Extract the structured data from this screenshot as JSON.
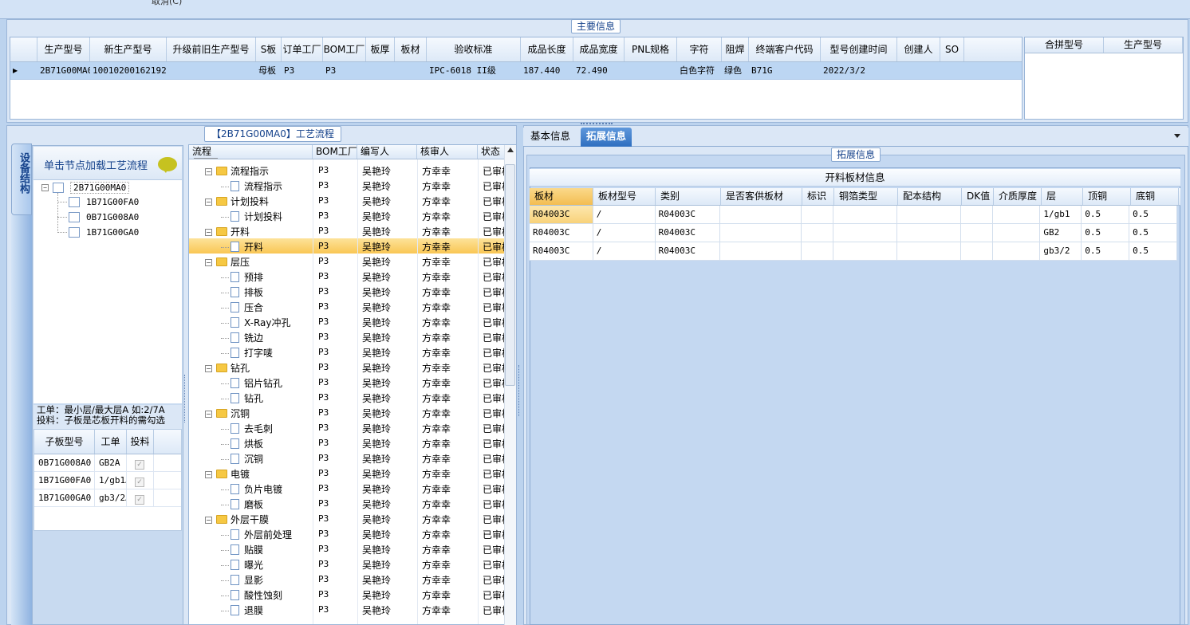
{
  "top_strip": {
    "partial_text": "取消(C)"
  },
  "main_info": {
    "title": "主要信息",
    "columns": [
      "生产型号",
      "新生产型号",
      "升级前旧生产型号",
      "S板",
      "订单工厂",
      "BOM工厂",
      "板厚",
      "板材",
      "验收标准",
      "成品长度",
      "成品宽度",
      "PNL规格",
      "字符",
      "阻焊",
      "终端客户代码",
      "型号创建时间",
      "创建人",
      "SO"
    ],
    "row": [
      "2B71G00MA0",
      "10010200162192",
      "",
      "母板",
      "P3",
      "P3",
      "",
      "",
      "IPC-6018 II级",
      "187.440",
      "72.490",
      "",
      "白色字符",
      "绿色",
      "B71G",
      "2022/3/2",
      "",
      ""
    ],
    "merge_columns": [
      "合拼型号",
      "生产型号"
    ]
  },
  "left": {
    "vertical_tab": "设备结构",
    "header_label": "单击节点加载工艺流程",
    "tree": {
      "root": "2B71G00MA0",
      "children": [
        "1B71G00FA0",
        "0B71G008A0",
        "1B71G00GA0"
      ]
    },
    "hint_line1": "工单：最小层/最大层A 如:2/7A",
    "hint_line2": "投料：子板是芯板开料的需勾选",
    "sub_columns": [
      "子板型号",
      "工单",
      "投料"
    ],
    "sub_rows": [
      {
        "model": "0B71G008A0",
        "order": "GB2A",
        "feed": true
      },
      {
        "model": "1B71G00FA0",
        "order": "1/gb1A",
        "feed": true
      },
      {
        "model": "1B71G00GA0",
        "order": "gb3/2A",
        "feed": true
      }
    ]
  },
  "process": {
    "title": "【2B71G00MA0】工艺流程",
    "columns": [
      "流程",
      "BOM工厂",
      "编写人",
      "核审人",
      "状态"
    ],
    "bom": "P3",
    "writer": "吴艳玲",
    "reviewer": "方幸幸",
    "status": "已审核",
    "rows": [
      {
        "label": "流程指示",
        "level": 0
      },
      {
        "label": "流程指示",
        "level": 1
      },
      {
        "label": "计划投料",
        "level": 0
      },
      {
        "label": "计划投料",
        "level": 1
      },
      {
        "label": "开料",
        "level": 0
      },
      {
        "label": "开料",
        "level": 1,
        "selected": true
      },
      {
        "label": "层压",
        "level": 0
      },
      {
        "label": "预排",
        "level": 1
      },
      {
        "label": "排板",
        "level": 1
      },
      {
        "label": "压合",
        "level": 1
      },
      {
        "label": "X-Ray冲孔",
        "level": 1
      },
      {
        "label": "铣边",
        "level": 1
      },
      {
        "label": "打字唛",
        "level": 1
      },
      {
        "label": "钻孔",
        "level": 0
      },
      {
        "label": "铝片钻孔",
        "level": 1
      },
      {
        "label": "钻孔",
        "level": 1
      },
      {
        "label": "沉铜",
        "level": 0
      },
      {
        "label": "去毛刺",
        "level": 1
      },
      {
        "label": "烘板",
        "level": 1
      },
      {
        "label": "沉铜",
        "level": 1
      },
      {
        "label": "电镀",
        "level": 0
      },
      {
        "label": "负片电镀",
        "level": 1
      },
      {
        "label": "磨板",
        "level": 1
      },
      {
        "label": "外层干膜",
        "level": 0
      },
      {
        "label": "外层前处理",
        "level": 1
      },
      {
        "label": "贴膜",
        "level": 1
      },
      {
        "label": "曝光",
        "level": 1
      },
      {
        "label": "显影",
        "level": 1
      },
      {
        "label": "酸性蚀刻",
        "level": 1
      },
      {
        "label": "退膜",
        "level": 1
      }
    ]
  },
  "right": {
    "tabs": [
      "基本信息",
      "拓展信息"
    ],
    "active_tab": "拓展信息",
    "group_title": "拓展信息",
    "table_title": "开料板材信息",
    "columns": [
      "板材",
      "板材型号",
      "类别",
      "是否客供板材",
      "标识",
      "铜箔类型",
      "配本结构",
      "DK值",
      "介质厚度",
      "层",
      "顶铜",
      "底铜"
    ],
    "rows": [
      [
        "R04003C",
        "/",
        "R04003C",
        "",
        "",
        "",
        "",
        "",
        "",
        "1/gb1",
        "0.5",
        "0.5"
      ],
      [
        "R04003C",
        "/",
        "R04003C",
        "",
        "",
        "",
        "",
        "",
        "",
        "GB2",
        "0.5",
        "0.5"
      ],
      [
        "R04003C",
        "/",
        "R04003C",
        "",
        "",
        "",
        "",
        "",
        "",
        "gb3/2",
        "0.5",
        "0.5"
      ]
    ]
  }
}
